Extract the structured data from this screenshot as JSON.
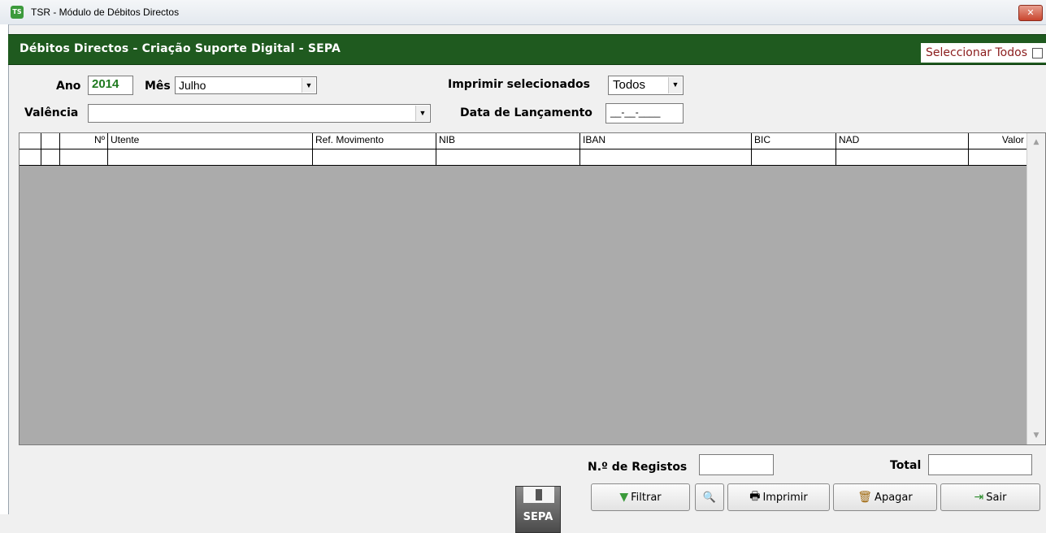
{
  "window": {
    "title": "TSR - Módulo de Débitos Directos",
    "app_icon": "TS",
    "close_icon": "close-icon"
  },
  "header": {
    "title": "Débitos Directos -  Criação Suporte Digital  - SEPA",
    "select_all_label": "Seleccionar Todos",
    "select_all_checked": false
  },
  "filters": {
    "ano_label": "Ano",
    "ano_value": "2014",
    "mes_label": "Mês",
    "mes_value": "Julho",
    "imprimir_label": "Imprimir selecionados",
    "imprimir_value": "Todos",
    "valencia_label": "Valência",
    "valencia_value": "",
    "data_label": "Data de Lançamento",
    "data_value": "__-__-____"
  },
  "grid": {
    "columns": [
      "",
      "",
      "Nº",
      "Utente",
      "Ref. Movimento",
      "NIB",
      "IBAN",
      "BIC",
      "NAD",
      "Valor"
    ],
    "rows": [
      [
        "",
        "",
        "",
        "",
        "",
        "",
        "",
        "",
        "",
        ""
      ]
    ]
  },
  "footer": {
    "sepa_label": "SEPA",
    "registos_label": "N.º de Registos",
    "registos_value": "",
    "total_label": "Total",
    "total_value": "",
    "filtrar_label": "Filtrar",
    "imprimir_label": "Imprimir",
    "apagar_label": "Apagar",
    "sair_label": "Sair"
  },
  "colors": {
    "header_band": "#1f5a1f",
    "ano_text": "#1f7a1f",
    "select_all_text": "#8b1c1c"
  }
}
